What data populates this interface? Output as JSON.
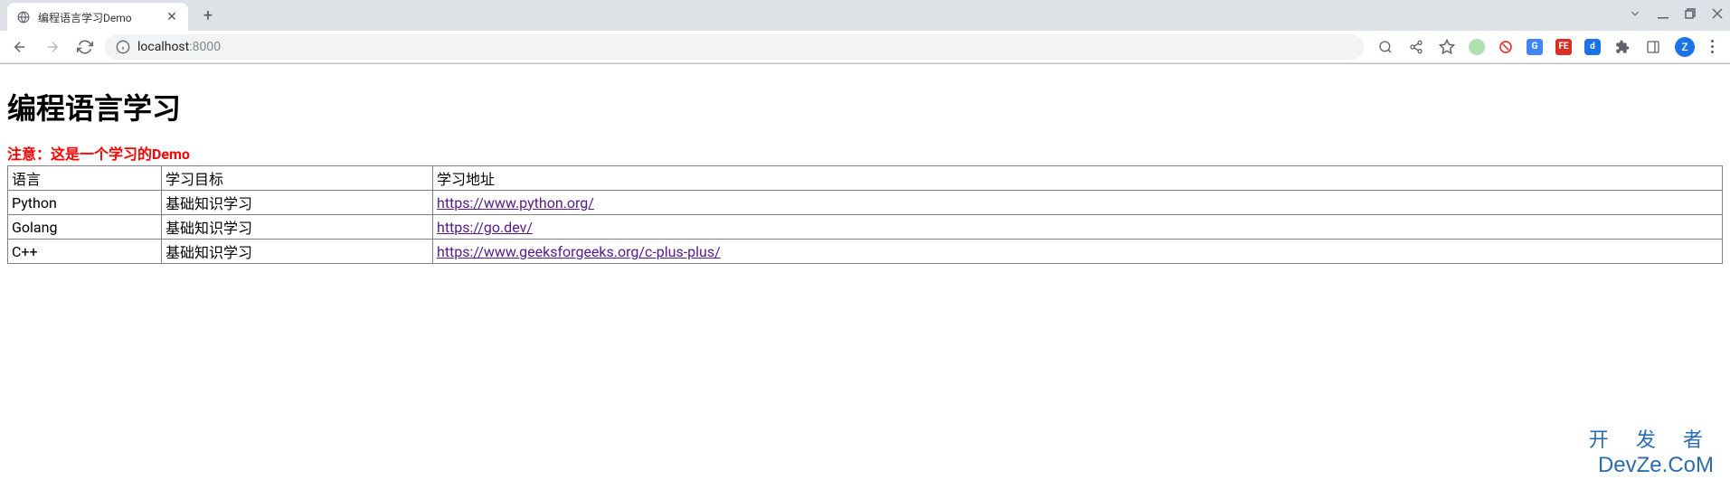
{
  "browser": {
    "tab_title": "编程语言学习Demo",
    "url_host": "localhost",
    "url_port": ":8000"
  },
  "page": {
    "heading": "编程语言学习",
    "warning": "注意：这是一个学习的Demo",
    "table": {
      "headers": [
        "语言",
        "学习目标",
        "学习地址"
      ],
      "rows": [
        {
          "lang": "Python",
          "goal": "基础知识学习",
          "url": "https://www.python.org/"
        },
        {
          "lang": "Golang",
          "goal": "基础知识学习",
          "url": "https://go.dev/"
        },
        {
          "lang": "C++",
          "goal": "基础知识学习",
          "url": "https://www.geeksforgeeks.org/c-plus-plus/"
        }
      ]
    }
  },
  "watermark": {
    "line1": "开 发 者",
    "line2": "DevZe.CoM"
  },
  "avatar": "Z"
}
